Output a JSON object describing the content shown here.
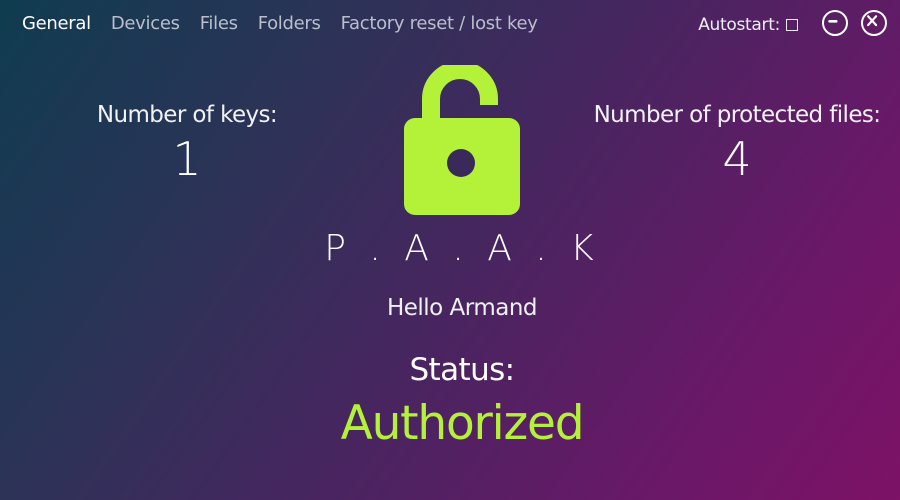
{
  "nav": {
    "items": [
      {
        "label": "General",
        "active": true
      },
      {
        "label": "Devices",
        "active": false
      },
      {
        "label": "Files",
        "active": false
      },
      {
        "label": "Folders",
        "active": false
      },
      {
        "label": "Factory reset / lost key",
        "active": false
      }
    ]
  },
  "autostart": {
    "label": "Autostart:",
    "checked": false
  },
  "window_controls": {
    "minimize_icon": "minus-circle-icon",
    "close_icon": "x-circle-icon"
  },
  "stats": {
    "keys_label": "Number of keys:",
    "keys_value": "1",
    "files_label": "Number of protected files:",
    "files_value": "4"
  },
  "lock": {
    "icon": "open-padlock-icon",
    "color": "#b4f23a",
    "state": "unlocked"
  },
  "brand": {
    "name": "P.A.A.K"
  },
  "greeting": "Hello Armand",
  "status": {
    "label": "Status:",
    "value": "Authorized",
    "color": "#b4f23a"
  },
  "theme": {
    "accent": "#b4f23a",
    "text": "#ffffff",
    "nav_inactive": "#b9bfcc"
  }
}
